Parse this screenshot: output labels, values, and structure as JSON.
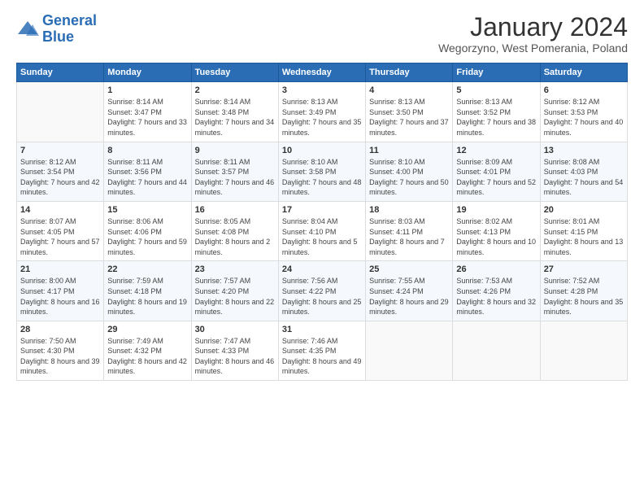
{
  "logo": {
    "line1": "General",
    "line2": "Blue"
  },
  "title": "January 2024",
  "subtitle": "Wegorzyno, West Pomerania, Poland",
  "headers": [
    "Sunday",
    "Monday",
    "Tuesday",
    "Wednesday",
    "Thursday",
    "Friday",
    "Saturday"
  ],
  "weeks": [
    [
      {
        "day": "",
        "sunrise": "",
        "sunset": "",
        "daylight": ""
      },
      {
        "day": "1",
        "sunrise": "Sunrise: 8:14 AM",
        "sunset": "Sunset: 3:47 PM",
        "daylight": "Daylight: 7 hours and 33 minutes."
      },
      {
        "day": "2",
        "sunrise": "Sunrise: 8:14 AM",
        "sunset": "Sunset: 3:48 PM",
        "daylight": "Daylight: 7 hours and 34 minutes."
      },
      {
        "day": "3",
        "sunrise": "Sunrise: 8:13 AM",
        "sunset": "Sunset: 3:49 PM",
        "daylight": "Daylight: 7 hours and 35 minutes."
      },
      {
        "day": "4",
        "sunrise": "Sunrise: 8:13 AM",
        "sunset": "Sunset: 3:50 PM",
        "daylight": "Daylight: 7 hours and 37 minutes."
      },
      {
        "day": "5",
        "sunrise": "Sunrise: 8:13 AM",
        "sunset": "Sunset: 3:52 PM",
        "daylight": "Daylight: 7 hours and 38 minutes."
      },
      {
        "day": "6",
        "sunrise": "Sunrise: 8:12 AM",
        "sunset": "Sunset: 3:53 PM",
        "daylight": "Daylight: 7 hours and 40 minutes."
      }
    ],
    [
      {
        "day": "7",
        "sunrise": "Sunrise: 8:12 AM",
        "sunset": "Sunset: 3:54 PM",
        "daylight": "Daylight: 7 hours and 42 minutes."
      },
      {
        "day": "8",
        "sunrise": "Sunrise: 8:11 AM",
        "sunset": "Sunset: 3:56 PM",
        "daylight": "Daylight: 7 hours and 44 minutes."
      },
      {
        "day": "9",
        "sunrise": "Sunrise: 8:11 AM",
        "sunset": "Sunset: 3:57 PM",
        "daylight": "Daylight: 7 hours and 46 minutes."
      },
      {
        "day": "10",
        "sunrise": "Sunrise: 8:10 AM",
        "sunset": "Sunset: 3:58 PM",
        "daylight": "Daylight: 7 hours and 48 minutes."
      },
      {
        "day": "11",
        "sunrise": "Sunrise: 8:10 AM",
        "sunset": "Sunset: 4:00 PM",
        "daylight": "Daylight: 7 hours and 50 minutes."
      },
      {
        "day": "12",
        "sunrise": "Sunrise: 8:09 AM",
        "sunset": "Sunset: 4:01 PM",
        "daylight": "Daylight: 7 hours and 52 minutes."
      },
      {
        "day": "13",
        "sunrise": "Sunrise: 8:08 AM",
        "sunset": "Sunset: 4:03 PM",
        "daylight": "Daylight: 7 hours and 54 minutes."
      }
    ],
    [
      {
        "day": "14",
        "sunrise": "Sunrise: 8:07 AM",
        "sunset": "Sunset: 4:05 PM",
        "daylight": "Daylight: 7 hours and 57 minutes."
      },
      {
        "day": "15",
        "sunrise": "Sunrise: 8:06 AM",
        "sunset": "Sunset: 4:06 PM",
        "daylight": "Daylight: 7 hours and 59 minutes."
      },
      {
        "day": "16",
        "sunrise": "Sunrise: 8:05 AM",
        "sunset": "Sunset: 4:08 PM",
        "daylight": "Daylight: 8 hours and 2 minutes."
      },
      {
        "day": "17",
        "sunrise": "Sunrise: 8:04 AM",
        "sunset": "Sunset: 4:10 PM",
        "daylight": "Daylight: 8 hours and 5 minutes."
      },
      {
        "day": "18",
        "sunrise": "Sunrise: 8:03 AM",
        "sunset": "Sunset: 4:11 PM",
        "daylight": "Daylight: 8 hours and 7 minutes."
      },
      {
        "day": "19",
        "sunrise": "Sunrise: 8:02 AM",
        "sunset": "Sunset: 4:13 PM",
        "daylight": "Daylight: 8 hours and 10 minutes."
      },
      {
        "day": "20",
        "sunrise": "Sunrise: 8:01 AM",
        "sunset": "Sunset: 4:15 PM",
        "daylight": "Daylight: 8 hours and 13 minutes."
      }
    ],
    [
      {
        "day": "21",
        "sunrise": "Sunrise: 8:00 AM",
        "sunset": "Sunset: 4:17 PM",
        "daylight": "Daylight: 8 hours and 16 minutes."
      },
      {
        "day": "22",
        "sunrise": "Sunrise: 7:59 AM",
        "sunset": "Sunset: 4:18 PM",
        "daylight": "Daylight: 8 hours and 19 minutes."
      },
      {
        "day": "23",
        "sunrise": "Sunrise: 7:57 AM",
        "sunset": "Sunset: 4:20 PM",
        "daylight": "Daylight: 8 hours and 22 minutes."
      },
      {
        "day": "24",
        "sunrise": "Sunrise: 7:56 AM",
        "sunset": "Sunset: 4:22 PM",
        "daylight": "Daylight: 8 hours and 25 minutes."
      },
      {
        "day": "25",
        "sunrise": "Sunrise: 7:55 AM",
        "sunset": "Sunset: 4:24 PM",
        "daylight": "Daylight: 8 hours and 29 minutes."
      },
      {
        "day": "26",
        "sunrise": "Sunrise: 7:53 AM",
        "sunset": "Sunset: 4:26 PM",
        "daylight": "Daylight: 8 hours and 32 minutes."
      },
      {
        "day": "27",
        "sunrise": "Sunrise: 7:52 AM",
        "sunset": "Sunset: 4:28 PM",
        "daylight": "Daylight: 8 hours and 35 minutes."
      }
    ],
    [
      {
        "day": "28",
        "sunrise": "Sunrise: 7:50 AM",
        "sunset": "Sunset: 4:30 PM",
        "daylight": "Daylight: 8 hours and 39 minutes."
      },
      {
        "day": "29",
        "sunrise": "Sunrise: 7:49 AM",
        "sunset": "Sunset: 4:32 PM",
        "daylight": "Daylight: 8 hours and 42 minutes."
      },
      {
        "day": "30",
        "sunrise": "Sunrise: 7:47 AM",
        "sunset": "Sunset: 4:33 PM",
        "daylight": "Daylight: 8 hours and 46 minutes."
      },
      {
        "day": "31",
        "sunrise": "Sunrise: 7:46 AM",
        "sunset": "Sunset: 4:35 PM",
        "daylight": "Daylight: 8 hours and 49 minutes."
      },
      {
        "day": "",
        "sunrise": "",
        "sunset": "",
        "daylight": ""
      },
      {
        "day": "",
        "sunrise": "",
        "sunset": "",
        "daylight": ""
      },
      {
        "day": "",
        "sunrise": "",
        "sunset": "",
        "daylight": ""
      }
    ]
  ]
}
